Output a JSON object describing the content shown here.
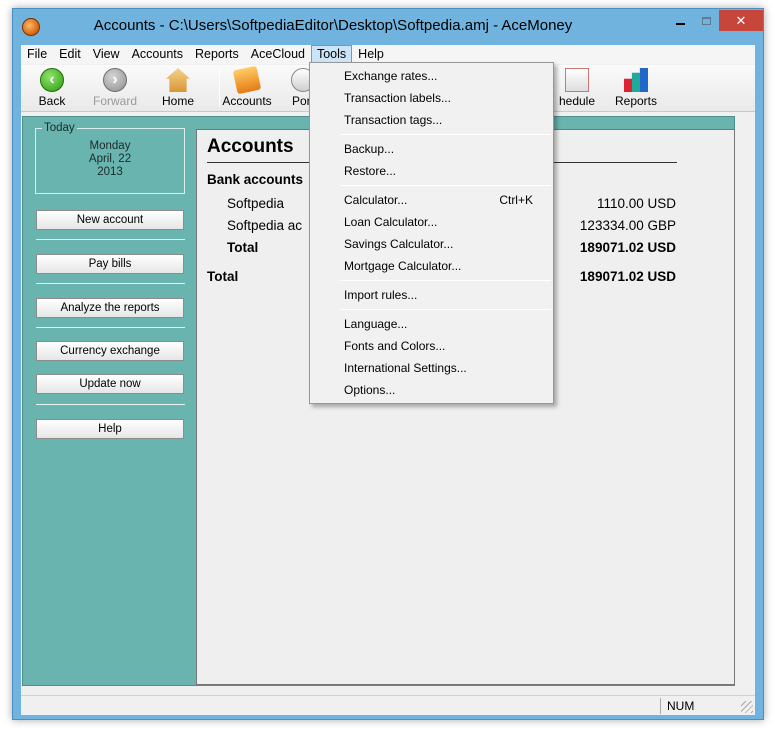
{
  "window": {
    "title": "Accounts - C:\\Users\\SoftpediaEditor\\Desktop\\Softpedia.amj - AceMoney",
    "close_label": "✕"
  },
  "menu": {
    "items": [
      "File",
      "Edit",
      "View",
      "Accounts",
      "Reports",
      "AceCloud",
      "Tools",
      "Help"
    ],
    "active": "Tools"
  },
  "toolbar": {
    "back": "Back",
    "forward": "Forward",
    "home": "Home",
    "accounts": "Accounts",
    "portfolio": "Port",
    "schedule": "hedule",
    "reports": "Reports"
  },
  "today": {
    "legend": "Today",
    "day": "Monday",
    "date": "April, 22",
    "year": "2013"
  },
  "sidebar": {
    "new_account": "New account",
    "pay_bills": "Pay bills",
    "analyze": "Analyze the reports",
    "currency": "Currency exchange",
    "update": "Update now",
    "help": "Help"
  },
  "panel": {
    "title": "Accounts",
    "section": "Bank accounts",
    "rows": [
      {
        "name": "Softpedia",
        "value": "1110.00 USD"
      },
      {
        "name": "Softpedia ac",
        "value": "123334.00 GBP"
      }
    ],
    "subtotal_label": "Total",
    "subtotal_value": "189071.02 USD",
    "total_label": "Total",
    "total_value": "189071.02 USD"
  },
  "tools_menu": {
    "exchange_rates": "Exchange rates...",
    "transaction_labels": "Transaction labels...",
    "transaction_tags": "Transaction tags...",
    "backup": "Backup...",
    "restore": "Restore...",
    "calculator": "Calculator...",
    "calculator_shortcut": "Ctrl+K",
    "loan_calculator": "Loan Calculator...",
    "savings_calculator": "Savings Calculator...",
    "mortgage_calculator": "Mortgage Calculator...",
    "import_rules": "Import rules...",
    "language": "Language...",
    "fonts_colors": "Fonts and Colors...",
    "international": "International Settings...",
    "options": "Options..."
  },
  "status": {
    "num": "NUM"
  }
}
